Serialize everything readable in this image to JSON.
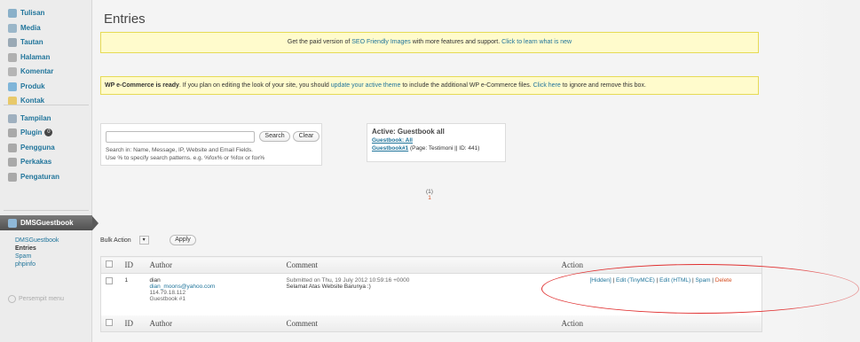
{
  "sidebar": {
    "items": [
      {
        "label": "Tulisan",
        "icon": "pin-icon",
        "color": "#8ab0c9"
      },
      {
        "label": "Media",
        "icon": "media-icon",
        "color": "#9bb7c9"
      },
      {
        "label": "Tautan",
        "icon": "link-icon",
        "color": "#9aa9b5"
      },
      {
        "label": "Halaman",
        "icon": "page-icon",
        "color": "#b0b0b0"
      },
      {
        "label": "Komentar",
        "icon": "comment-icon",
        "color": "#b5b5b5"
      },
      {
        "label": "Produk",
        "icon": "product-icon",
        "color": "#7fb5d9"
      },
      {
        "label": "Kontak",
        "icon": "contact-icon",
        "color": "#e8c96a"
      },
      {
        "label": "Tampilan",
        "icon": "appearance-icon",
        "color": "#9fb0bf"
      },
      {
        "label": "Plugin",
        "icon": "plugin-icon",
        "color": "#a9a9a9",
        "badge": "0"
      },
      {
        "label": "Pengguna",
        "icon": "users-icon",
        "color": "#a9a9a9"
      },
      {
        "label": "Perkakas",
        "icon": "tools-icon",
        "color": "#a9a9a9"
      },
      {
        "label": "Pengaturan",
        "icon": "settings-icon",
        "color": "#a9a9a9"
      }
    ],
    "active": {
      "label": "DMSGuestbook"
    },
    "submenu": [
      "DMSGuestbook",
      "Entries",
      "Spam",
      "phpinfo"
    ],
    "collapse_label": "Persempit menu"
  },
  "page_title": "Entries",
  "notice1": {
    "pre": "Get the paid version of ",
    "link1": "SEO Friendly Images",
    "mid": " with more features and support. ",
    "link2": "Click to learn what is new"
  },
  "notice2": {
    "strong": "WP e-Commerce is ready",
    "pre": ". If you plan on editing the look of your site, you should ",
    "link1": "update your active theme",
    "mid": " to include the additional WP e-Commerce files. ",
    "link2": "Click here",
    "post": " to ignore and remove this box."
  },
  "search": {
    "value": "",
    "search_label": "Search",
    "clear_label": "Clear",
    "hint1": "Search in: Name, Message, IP, Website and Email Fields.",
    "hint2": "Use % to specify search patterns. e.g. %fox% or %fox or fox%"
  },
  "active_guestbook": {
    "title": "Active: Guestbook all",
    "link_all": "Guestbook: All",
    "link_one": "Guestbook#1",
    "page_info": " (Page: Testimoni || ID: 441)"
  },
  "pager": {
    "current": "(1)",
    "page": "1"
  },
  "bulk": {
    "label": "Bulk Action",
    "apply_label": "Apply"
  },
  "table": {
    "headers": [
      "ID",
      "Author",
      "Comment",
      "Action"
    ],
    "rows": [
      {
        "id": "1",
        "author": "dian",
        "email": "dian_moons@yahoo.com",
        "ip": "114.79.18.112",
        "guestbook": "Guestbook #1",
        "submitted": "Submitted on Thu, 19 July 2012 10:59:16 +0000",
        "message": "Selamat Atas Website Barunya :)",
        "actions": {
          "hidden": "[Hidden]",
          "edit_tinymce": "Edit (TinyMCE)",
          "edit_html": "Edit (HTML)",
          "spam": "Spam",
          "delete": "Delete",
          "sep": " | "
        }
      }
    ]
  },
  "colors": {
    "link": "#21759b",
    "notice_bg": "#fffbcc",
    "delete": "#d54e21",
    "annotation": "#e03030"
  }
}
